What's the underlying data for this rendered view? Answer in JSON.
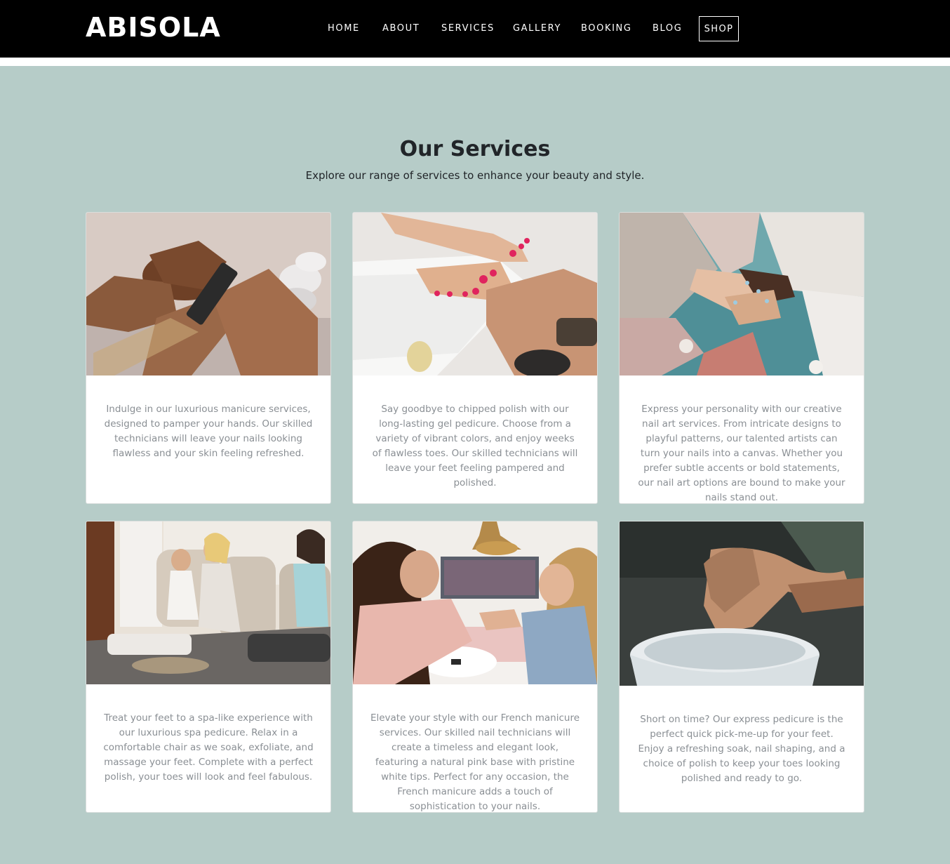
{
  "header": {
    "brand": "ABISOLA",
    "nav": {
      "home": "HOME",
      "about": "ABOUT",
      "services": "SERVICES",
      "gallery": "GALLERY",
      "booking": "BOOKING",
      "blog": "BLOG",
      "shop": "SHOP"
    }
  },
  "services": {
    "title": "Our Services",
    "subtitle": "Explore our range of services to enhance your beauty and style.",
    "cards": [
      {
        "image": "manicure-photo",
        "description": "Indulge in our luxurious manicure services, designed to pamper your hands. Our skilled technicians will leave your nails looking flawless and your skin feeling refreshed."
      },
      {
        "image": "gel-pedicure-photo",
        "description": "Say goodbye to chipped polish with our long-lasting gel pedicure. Choose from a variety of vibrant colors, and enjoy weeks of flawless toes. Our skilled technicians will leave your feet feeling pampered and polished."
      },
      {
        "image": "nail-art-hands-photo",
        "description": "Express your personality with our creative nail art services. From intricate designs to playful patterns, our talented artists can turn your nails into a canvas. Whether you prefer subtle accents or bold statements, our nail art options are bound to make your nails stand out."
      },
      {
        "image": "spa-pedicure-photo",
        "description": "Treat your feet to a spa-like experience with our luxurious spa pedicure. Relax in a comfortable chair as we soak, exfoliate, and massage your feet. Complete with a perfect polish, your toes will look and feel fabulous."
      },
      {
        "image": "french-manicure-photo",
        "description": "Elevate your style with our French manicure services. Our skilled nail technicians will create a timeless and elegant look, featuring a natural pink base with pristine white tips. Perfect for any occasion, the French manicure adds a touch of sophistication to your nails."
      },
      {
        "image": "express-pedicure-photo",
        "description": "Short on time? Our express pedicure is the perfect quick pick-me-up for your feet. Enjoy a refreshing soak, nail shaping, and a choice of polish to keep your toes looking polished and ready to go."
      }
    ]
  },
  "colors": {
    "header_bg": "#000000",
    "section_bg": "#b6ccc8",
    "card_text": "#8a8f94",
    "heading": "#212529"
  }
}
